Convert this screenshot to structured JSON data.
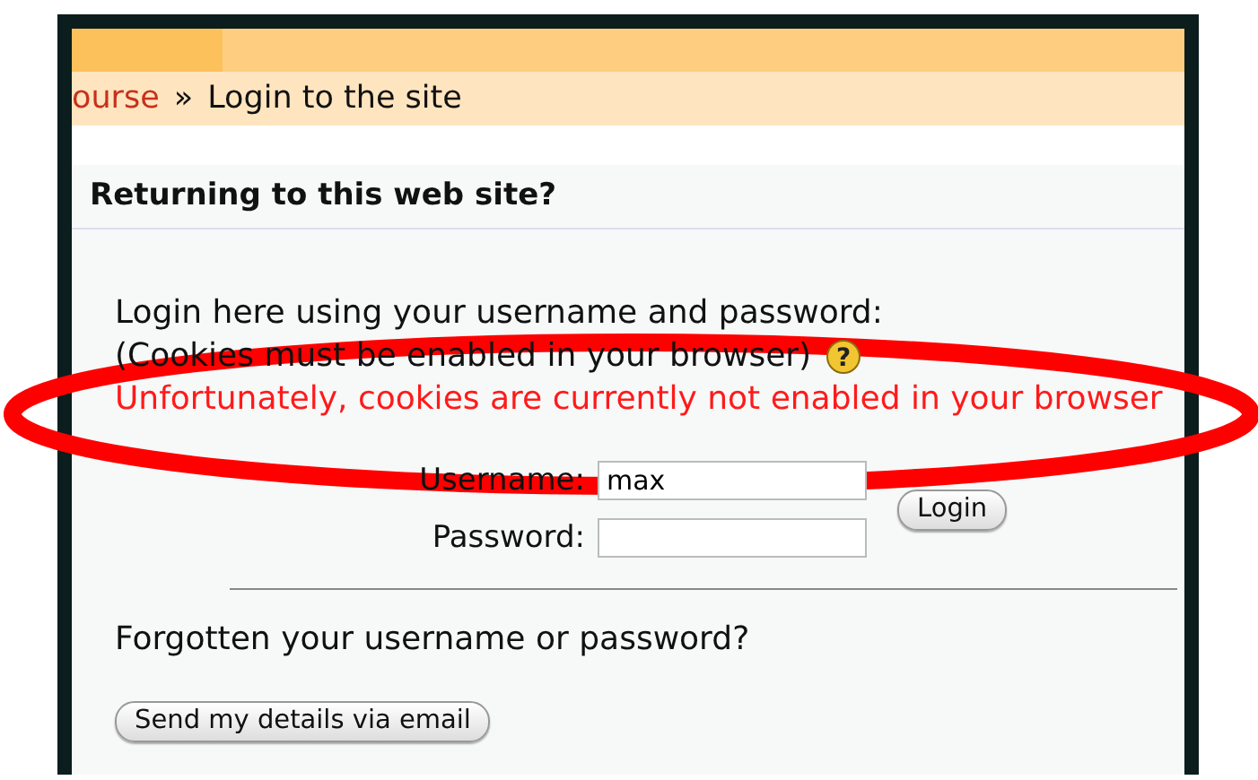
{
  "breadcrumb": {
    "link": "ourse",
    "separator": "»",
    "current": "Login to the site"
  },
  "panel": {
    "title": "Returning to this web site?",
    "intro": "Login here using your username and password:",
    "cookie_note": "(Cookies must be enabled in your browser)",
    "help_icon": {
      "glyph": "?"
    },
    "error": "Unfortunately, cookies are currently not enabled in your browser",
    "fields": [
      {
        "label": "Username:",
        "value": "max"
      },
      {
        "label": "Password:"
      }
    ],
    "login_button": "Login",
    "forgot": "Forgotten your username or password?",
    "send_button": "Send my details via email"
  },
  "annotation": {
    "kind": "ellipse",
    "color": "#ff0000"
  }
}
